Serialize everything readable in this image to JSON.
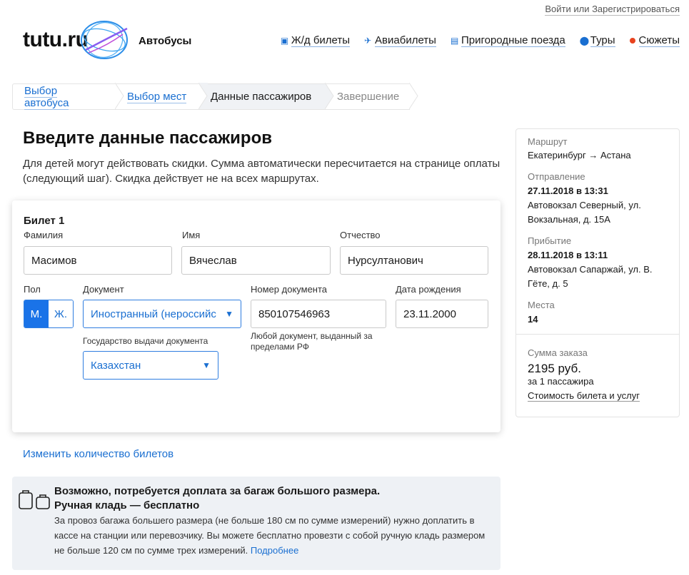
{
  "header": {
    "login_link": "Войти или Зарегистрироваться",
    "logo_text": "tutu.ru",
    "section_title": "Автобусы",
    "nav": [
      {
        "label": "Ж/д билеты",
        "icon": "train-icon"
      },
      {
        "label": "Авиабилеты",
        "icon": "plane-icon"
      },
      {
        "label": "Пригородные поезда",
        "icon": "commuter-train-icon"
      },
      {
        "label": "Туры",
        "icon": "location-pin-icon"
      },
      {
        "label": "Сюжеты",
        "icon": "dot-icon"
      }
    ]
  },
  "steps": [
    {
      "label": "Выбор автобуса",
      "state": "link"
    },
    {
      "label": "Выбор мест",
      "state": "link"
    },
    {
      "label": "Данные пассажиров",
      "state": "active"
    },
    {
      "label": "Завершение",
      "state": "disabled"
    }
  ],
  "page": {
    "title": "Введите данные пассажиров",
    "intro": "Для детей могут действовать скидки. Сумма автоматически пересчитается на странице оплаты (следующий шаг). Скидка действует не на всех маршрутах."
  },
  "ticket": {
    "title": "Билет 1",
    "surname_label": "Фамилия",
    "surname_value": "Масимов",
    "name_label": "Имя",
    "name_value": "Вячеслав",
    "patronymic_label": "Отчество",
    "patronymic_value": "Нурсултанович",
    "gender_label": "Пол",
    "gender_male": "М.",
    "gender_female": "Ж.",
    "document_label": "Документ",
    "document_value": "Иностранный (нероссийс",
    "doc_number_label": "Номер документа",
    "doc_number_value": "850107546963",
    "doc_number_hint": "Любой документ, выданный за пределами РФ",
    "birthdate_label": "Дата рождения",
    "birthdate_value": "23.11.2000",
    "issuer_country_label": "Государство выдачи документа",
    "issuer_country_value": "Казахстан"
  },
  "change_tickets_link": "Изменить количество билетов",
  "baggage": {
    "title": "Возможно, потребуется доплата за багаж большого размера.",
    "subtitle": "Ручная кладь — бесплатно",
    "text": "За провоз багажа большего размера (не больше 180 см по сумме измерений) нужно доплатить в кассе на станции или перевозчику. Вы можете бесплатно провезти с собой ручную кладь размером не больше 120 см по сумме трех измерений.",
    "more_link": "Подробнее"
  },
  "sidebar": {
    "route_label": "Маршрут",
    "route_value": "Екатеринбург → Астана",
    "departure_label": "Отправление",
    "departure_datetime": "27.11.2018 в 13:31",
    "departure_place": "Автовокзал Северный, ул. Вокзальная, д. 15А",
    "arrival_label": "Прибытие",
    "arrival_datetime": "28.11.2018 в 13:11",
    "arrival_place": "Автовокзал Сапаржай, ул. В. Гёте, д. 5",
    "seats_label": "Места",
    "seats_value": "14",
    "sum_label": "Сумма заказа",
    "sum_value": "2195 руб.",
    "sum_for": "за 1 пассажира",
    "cost_link": "Стоимость билета и услуг"
  },
  "colors": {
    "accent": "#1a73e8",
    "link": "#1a6fd1",
    "notice_bg": "#eef1f5",
    "dot": "#e8431f"
  }
}
